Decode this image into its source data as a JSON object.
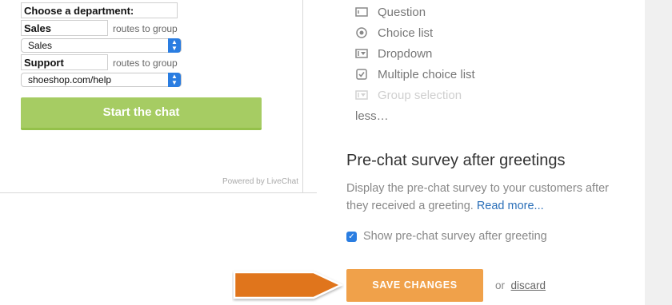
{
  "preview": {
    "department_label": "Choose a department:",
    "rows": [
      {
        "name": "Sales",
        "routes_text": "routes to group",
        "select_value": "Sales"
      },
      {
        "name": "Support",
        "routes_text": "routes to group",
        "select_value": "shoeshop.com/help"
      }
    ],
    "start_button": "Start the chat",
    "powered_by": "Powered by LiveChat"
  },
  "field_types": [
    {
      "label": "Question",
      "icon": "question-icon",
      "disabled": false
    },
    {
      "label": "Choice list",
      "icon": "radio-icon",
      "disabled": false
    },
    {
      "label": "Dropdown",
      "icon": "dropdown-icon",
      "disabled": false
    },
    {
      "label": "Multiple choice list",
      "icon": "checkbox-icon",
      "disabled": false
    },
    {
      "label": "Group selection",
      "icon": "dropdown-icon",
      "disabled": true
    }
  ],
  "less_link": "less…",
  "section": {
    "title": "Pre-chat survey after greetings",
    "description": "Display the pre-chat survey to your customers after they received a greeting.",
    "read_more": "Read more...",
    "checkbox_label": "Show pre-chat survey after greeting",
    "checkbox_checked": true
  },
  "actions": {
    "save_label": "SAVE CHANGES",
    "or_text": "or",
    "discard_label": "discard"
  },
  "colors": {
    "start_button": "#a6cc63",
    "save_button": "#f0a14a",
    "arrow": "#e0741a",
    "link": "#2a6fb8",
    "checkbox": "#2a7de1"
  }
}
